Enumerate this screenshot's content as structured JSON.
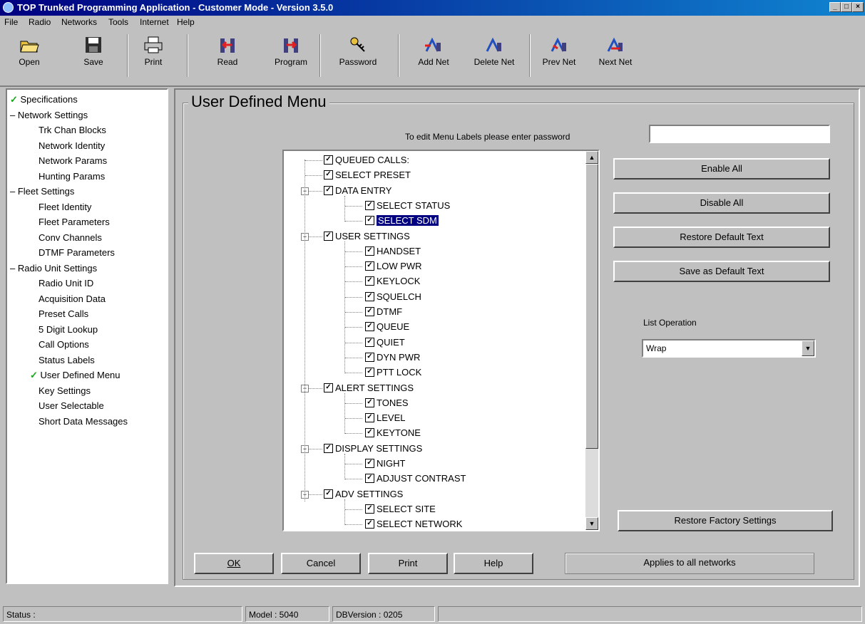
{
  "window": {
    "title": "TOP Trunked Programming Application - Customer Mode - Version 3.5.0",
    "controls": [
      "_",
      "□",
      "×"
    ]
  },
  "menu": [
    "File",
    "Radio",
    "Networks",
    "Tools",
    "Internet",
    "Help"
  ],
  "toolbar": [
    {
      "label": "Open",
      "icon": "open-folder-icon"
    },
    {
      "label": "Save",
      "icon": "save-disk-icon"
    },
    {
      "label": "Print",
      "icon": "printer-icon"
    },
    {
      "label": "Read",
      "icon": "read-radio-icon"
    },
    {
      "label": "Program",
      "icon": "program-radio-icon"
    },
    {
      "label": "Password",
      "icon": "key-icon"
    },
    {
      "label": "Add Net",
      "icon": "add-net-icon"
    },
    {
      "label": "Delete Net",
      "icon": "delete-net-icon"
    },
    {
      "label": "Prev Net",
      "icon": "prev-net-icon"
    },
    {
      "label": "Next Net",
      "icon": "next-net-icon"
    }
  ],
  "nav": [
    {
      "label": "Specifications",
      "level": 0,
      "checked": true
    },
    {
      "label": "Network Settings",
      "level": 0,
      "expanded": true
    },
    {
      "label": "Trk Chan Blocks",
      "level": 1
    },
    {
      "label": "Network Identity",
      "level": 1
    },
    {
      "label": "Network Params",
      "level": 1
    },
    {
      "label": "Hunting Params",
      "level": 1
    },
    {
      "label": "Fleet Settings",
      "level": 0,
      "expanded": true
    },
    {
      "label": "Fleet Identity",
      "level": 1
    },
    {
      "label": "Fleet Parameters",
      "level": 1
    },
    {
      "label": "Conv Channels",
      "level": 1
    },
    {
      "label": "DTMF Parameters",
      "level": 1
    },
    {
      "label": "Radio Unit Settings",
      "level": 0,
      "expanded": true
    },
    {
      "label": "Radio Unit ID",
      "level": 1
    },
    {
      "label": "Acquisition Data",
      "level": 1
    },
    {
      "label": "Preset Calls",
      "level": 1
    },
    {
      "label": "5 Digit Lookup",
      "level": 1
    },
    {
      "label": "Call Options",
      "level": 1
    },
    {
      "label": "Status Labels",
      "level": 1
    },
    {
      "label": "User Defined Menu",
      "level": 1,
      "checked": true
    },
    {
      "label": "Key Settings",
      "level": 1
    },
    {
      "label": "User Selectable",
      "level": 1
    },
    {
      "label": "Short Data Messages",
      "level": 1
    }
  ],
  "panel": {
    "title": "User Defined Menu",
    "password_prompt": "To edit Menu Labels please enter password",
    "password_value": "",
    "list_operation_label": "List Operation",
    "list_operation_value": "Wrap"
  },
  "menu_tree": [
    {
      "label": "QUEUED CALLS:",
      "level": 0,
      "checked": true
    },
    {
      "label": "SELECT PRESET",
      "level": 0,
      "checked": true
    },
    {
      "label": "DATA ENTRY",
      "level": 0,
      "checked": true,
      "expander": "−"
    },
    {
      "label": "SELECT STATUS",
      "level": 1,
      "checked": true
    },
    {
      "label": "SELECT SDM",
      "level": 1,
      "checked": true,
      "selected": true
    },
    {
      "label": "USER SETTINGS",
      "level": 0,
      "checked": true,
      "expander": "−"
    },
    {
      "label": "HANDSET",
      "level": 1,
      "checked": true
    },
    {
      "label": "LOW PWR",
      "level": 1,
      "checked": true
    },
    {
      "label": "KEYLOCK",
      "level": 1,
      "checked": true
    },
    {
      "label": "SQUELCH",
      "level": 1,
      "checked": true
    },
    {
      "label": "DTMF",
      "level": 1,
      "checked": true
    },
    {
      "label": "QUEUE",
      "level": 1,
      "checked": true
    },
    {
      "label": "QUIET",
      "level": 1,
      "checked": true
    },
    {
      "label": "DYN PWR",
      "level": 1,
      "checked": true
    },
    {
      "label": "PTT LOCK",
      "level": 1,
      "checked": true
    },
    {
      "label": "ALERT SETTINGS",
      "level": 0,
      "checked": true,
      "expander": "−"
    },
    {
      "label": "TONES",
      "level": 1,
      "checked": true
    },
    {
      "label": "LEVEL",
      "level": 1,
      "checked": true
    },
    {
      "label": "KEYTONE",
      "level": 1,
      "checked": true
    },
    {
      "label": "DISPLAY SETTINGS",
      "level": 0,
      "checked": true,
      "expander": "−"
    },
    {
      "label": "NIGHT",
      "level": 1,
      "checked": true
    },
    {
      "label": "ADJUST CONTRAST",
      "level": 1,
      "checked": true
    },
    {
      "label": "ADV SETTINGS",
      "level": 0,
      "checked": true,
      "expander": "−"
    },
    {
      "label": "SELECT SITE",
      "level": 1,
      "checked": true
    },
    {
      "label": "SELECT NETWORK",
      "level": 1,
      "checked": true
    }
  ],
  "side_buttons": {
    "enable_all": "Enable All",
    "disable_all": "Disable All",
    "restore_default": "Restore Default Text",
    "save_default": "Save as Default Text",
    "restore_factory": "Restore Factory Settings"
  },
  "bottom_buttons": {
    "ok": "OK",
    "cancel": "Cancel",
    "print": "Print",
    "help": "Help",
    "applies": "Applies to all networks"
  },
  "status": {
    "status": "Status :",
    "model": "Model : 5040",
    "db_version": "DBVersion : 0205"
  }
}
